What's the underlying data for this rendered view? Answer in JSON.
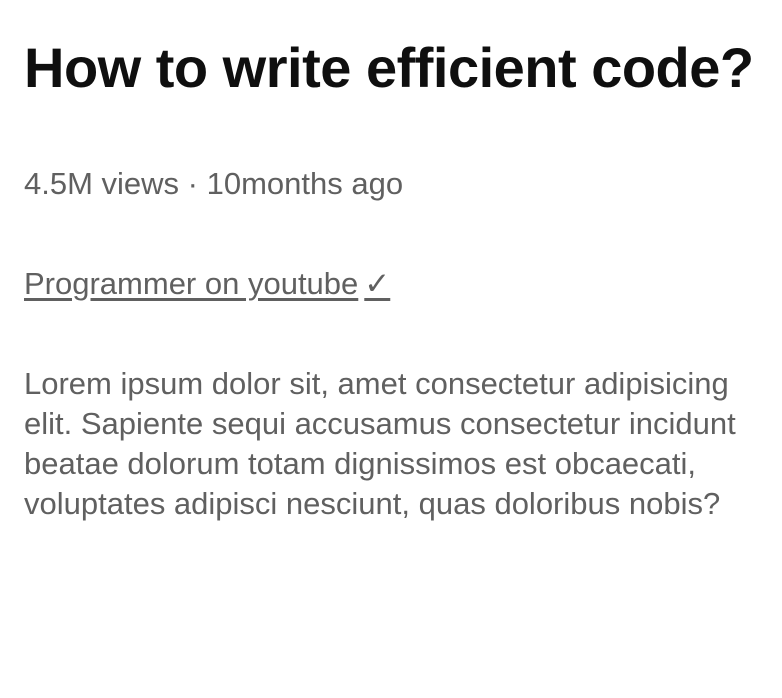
{
  "video": {
    "title": "How to write efficient code?",
    "views": "4.5M views",
    "separator": "·",
    "age": "10months ago",
    "channel": {
      "name": "Programmer on youtube",
      "verified_glyph": "✓",
      "icon": "verified-check-icon"
    },
    "description": "Lorem ipsum dolor sit, amet consectetur adipisicing elit. Sapiente sequi accusamus consectetur incidunt beatae dolorum totam dignissimos est obcaecati, voluptates adipisci nesciunt, quas doloribus nobis?"
  },
  "colors": {
    "title": "#0f0f0f",
    "secondary_text": "#606060",
    "background": "#ffffff"
  }
}
